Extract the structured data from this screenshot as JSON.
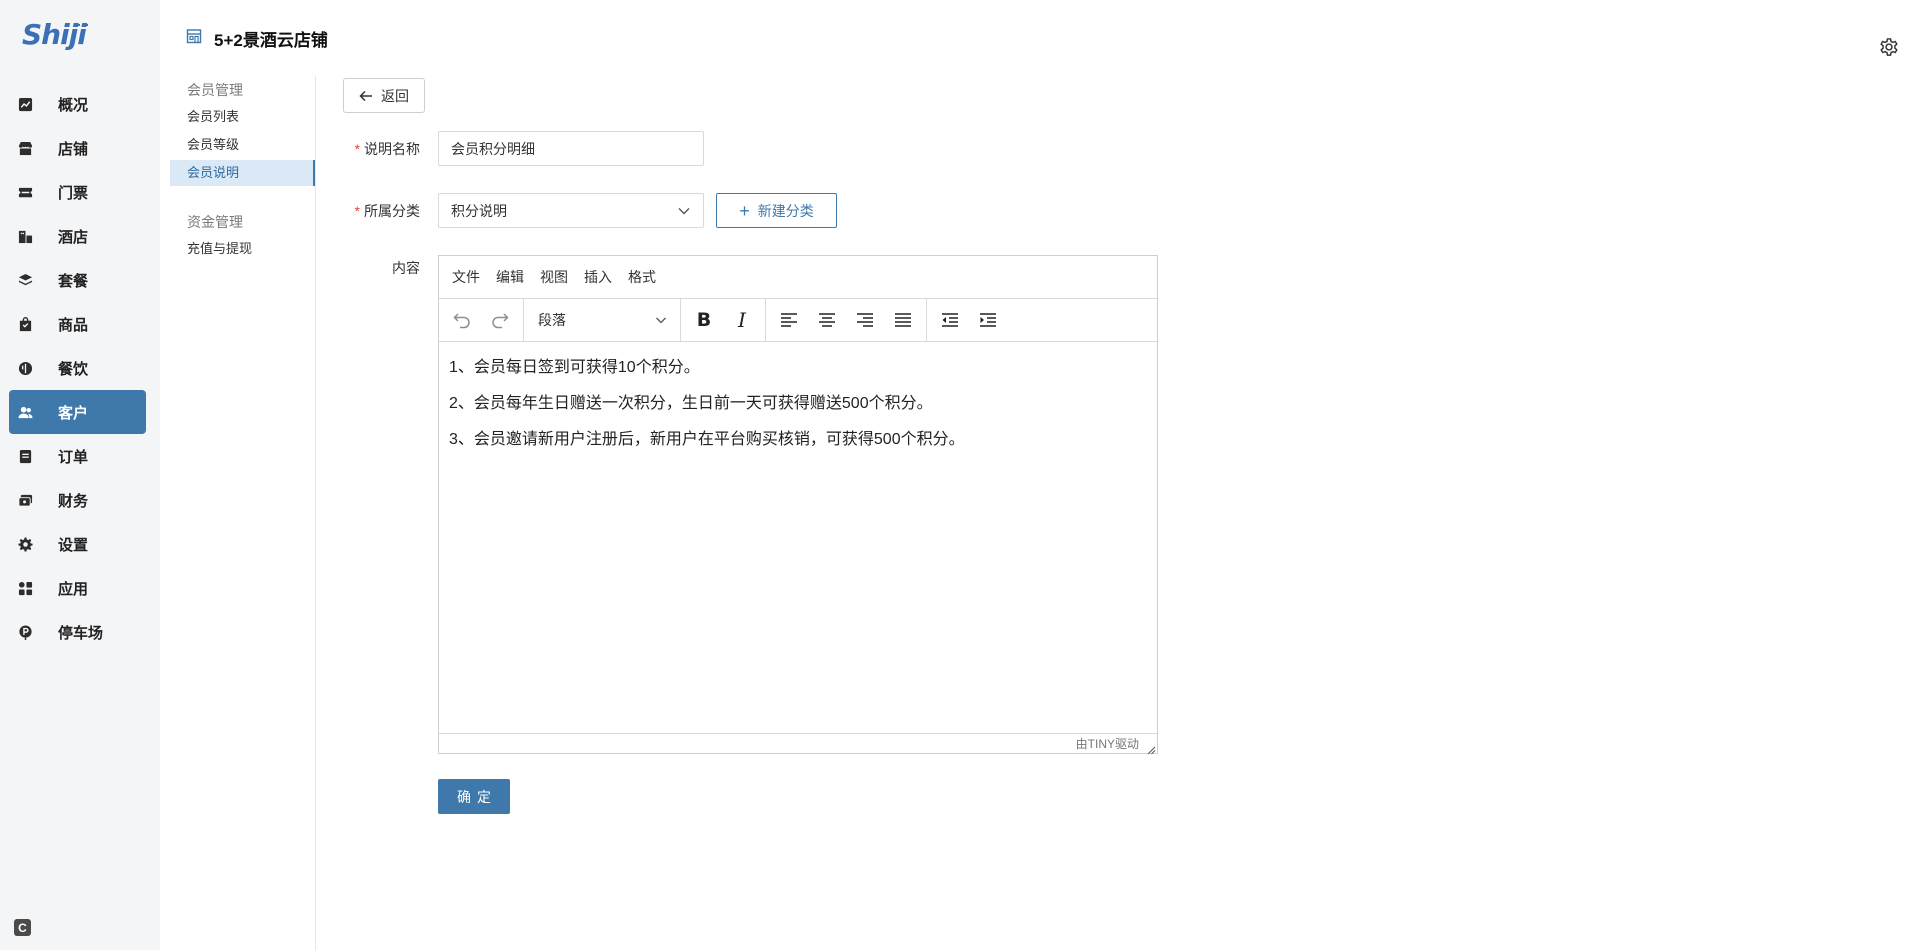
{
  "logo": {
    "text": "Shiji"
  },
  "sidebar": {
    "items": [
      {
        "label": "概况",
        "icon": "chart-icon"
      },
      {
        "label": "店铺",
        "icon": "store-icon"
      },
      {
        "label": "门票",
        "icon": "ticket-icon"
      },
      {
        "label": "酒店",
        "icon": "hotel-icon"
      },
      {
        "label": "套餐",
        "icon": "layers-icon"
      },
      {
        "label": "商品",
        "icon": "bag-icon"
      },
      {
        "label": "餐饮",
        "icon": "dining-icon"
      },
      {
        "label": "客户",
        "icon": "users-icon",
        "active": true
      },
      {
        "label": "订单",
        "icon": "document-icon"
      },
      {
        "label": "财务",
        "icon": "wallet-icon"
      },
      {
        "label": "设置",
        "icon": "gear-icon"
      },
      {
        "label": "应用",
        "icon": "apps-icon"
      },
      {
        "label": "停车场",
        "icon": "parking-icon"
      }
    ],
    "bottom_badge": "C"
  },
  "header": {
    "title": "5+2景酒云店铺"
  },
  "submenu": {
    "group1": "会员管理",
    "group1_items": [
      "会员列表",
      "会员等级",
      "会员说明"
    ],
    "active_item": "会员说明",
    "group2": "资金管理",
    "group2_items": [
      "充值与提现"
    ]
  },
  "form": {
    "back_label": "返回",
    "name_label": "说明名称",
    "name_value": "会员积分明细",
    "category_label": "所属分类",
    "category_value": "积分说明",
    "new_category_label": "新建分类",
    "content_label": "内容",
    "confirm_label": "确定"
  },
  "editor": {
    "menus": [
      "文件",
      "编辑",
      "视图",
      "插入",
      "格式"
    ],
    "block_format": "段落",
    "paragraphs": [
      "1、会员每日签到可获得10个积分。",
      "2、会员每年生日赠送一次积分，生日前一天可获得赠送500个积分。",
      "3、会员邀请新用户注册后，新用户在平台购买核销，可获得500个积分。"
    ],
    "powered_by": "由TINY驱动"
  },
  "colors": {
    "accent": "#3f78ab",
    "required": "#e2443c",
    "sidebar_bg": "#f4f5f7",
    "active_sub_bg": "#dbe8f5"
  }
}
